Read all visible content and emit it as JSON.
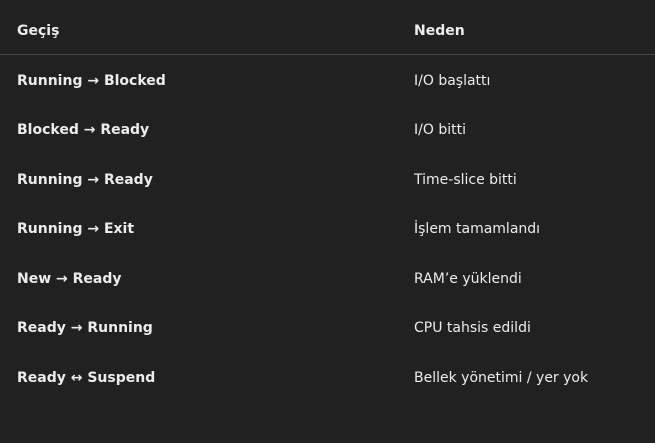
{
  "table": {
    "headers": [
      "Geçiş",
      "Neden"
    ],
    "rows": [
      {
        "transition": "Running → Blocked",
        "reason": "I/O başlattı"
      },
      {
        "transition": "Blocked → Ready",
        "reason": "I/O bitti"
      },
      {
        "transition": "Running → Ready",
        "reason": "Time-slice bitti"
      },
      {
        "transition": "Running → Exit",
        "reason": "İşlem tamamlandı"
      },
      {
        "transition": "New → Ready",
        "reason": "RAM’e yüklendi"
      },
      {
        "transition": "Ready → Running",
        "reason": "CPU tahsis edildi"
      },
      {
        "transition": "Ready ↔ Suspend",
        "reason": "Bellek yönetimi / yer yok"
      }
    ]
  },
  "colors": {
    "background": "#212121",
    "text": "#ececec",
    "divider": "#444444"
  }
}
